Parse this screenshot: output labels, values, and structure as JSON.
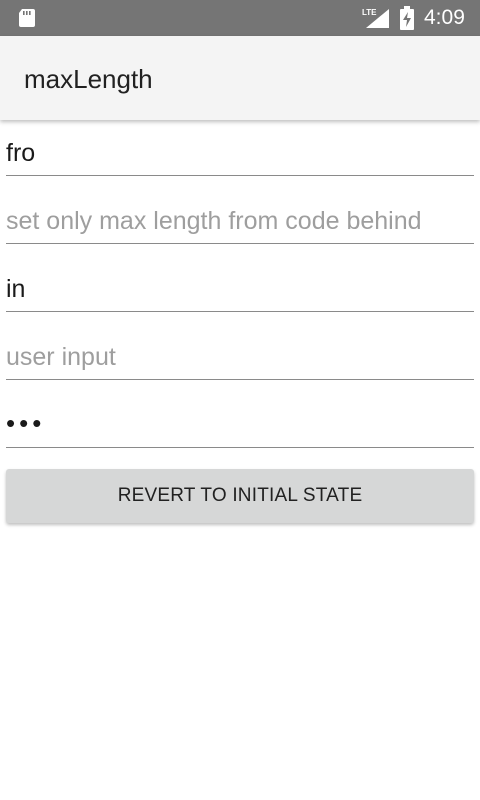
{
  "status_bar": {
    "time": "4:09",
    "icons": [
      "sd-card-icon",
      "lte-signal-icon",
      "battery-charging-icon"
    ],
    "network_label": "LTE"
  },
  "app_bar": {
    "title": "maxLength"
  },
  "fields": [
    {
      "value": "fro",
      "placeholder": ""
    },
    {
      "value": "",
      "placeholder": "set only max length from code behind"
    },
    {
      "value": "in",
      "placeholder": ""
    },
    {
      "value": "",
      "placeholder": "user input"
    },
    {
      "value": "•••",
      "placeholder": "",
      "type": "password"
    }
  ],
  "revert_button": {
    "label": "REVERT TO INITIAL STATE"
  },
  "colors": {
    "status_bar": "#757575",
    "app_bar": "#f4f4f4",
    "button": "#d6d7d7",
    "hint_text": "#9e9e9e",
    "underline": "#8a8a8a"
  }
}
